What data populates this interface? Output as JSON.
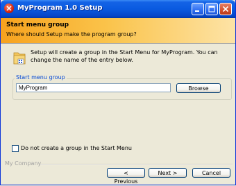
{
  "window": {
    "title": "MyProgram 1.0 Setup"
  },
  "header": {
    "title": "Start menu group",
    "subtitle": "Where should Setup make the program group?"
  },
  "body": {
    "description": "Setup will create a group in the Start Menu for MyProgram. You can change the name of the entry below.",
    "group_label": "Start menu group",
    "group_value": "MyProgram",
    "browse_label": "Browse",
    "no_group_label": "Do not create a group in the Start Menu",
    "no_group_checked": false
  },
  "footer": {
    "company": "My Company",
    "previous_label": "< Previous",
    "next_label": "Next >",
    "cancel_label": "Cancel"
  },
  "colors": {
    "titlebar": "#0a5ae0",
    "header_start": "#f7a21e",
    "header_end": "#fde3a6",
    "group_label": "#0046d5"
  },
  "icons": [
    "app-icon",
    "minimize-icon",
    "maximize-icon",
    "close-icon",
    "program-group-icon"
  ]
}
